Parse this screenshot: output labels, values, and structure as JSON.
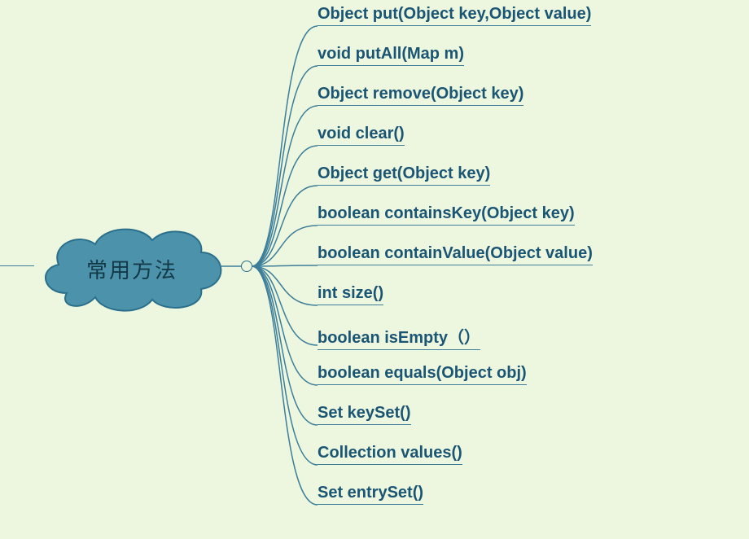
{
  "root": {
    "label": "常用方法"
  },
  "branches": [
    {
      "text": "Object put(Object key,Object value)"
    },
    {
      "text": "void putAll(Map m)"
    },
    {
      "text": "Object remove(Object key)"
    },
    {
      "text": "void clear()"
    },
    {
      "text": "Object get(Object key)"
    },
    {
      "text": "boolean containsKey(Object key)"
    },
    {
      "text": "boolean containValue(Object value)"
    },
    {
      "text": "int size()"
    },
    {
      "text": "boolean isEmpty（）"
    },
    {
      "text": "boolean equals(Object obj)"
    },
    {
      "text": "Set keySet()"
    },
    {
      "text": "Collection values()"
    },
    {
      "text": "Set entrySet()"
    }
  ],
  "colors": {
    "bg": "#edf7df",
    "cloudFill": "#4d92ab",
    "cloudStroke": "#2a6f8c",
    "line": "#3d7e9a",
    "text": "#1b5574"
  },
  "chart_data": {
    "type": "mindmap",
    "root": "常用方法",
    "children": [
      "Object put(Object key,Object value)",
      "void putAll(Map m)",
      "Object remove(Object key)",
      "void clear()",
      "Object get(Object key)",
      "boolean containsKey(Object key)",
      "boolean containValue(Object value)",
      "int size()",
      "boolean isEmpty（）",
      "boolean equals(Object obj)",
      "Set keySet()",
      "Collection values()",
      "Set entrySet()"
    ]
  }
}
